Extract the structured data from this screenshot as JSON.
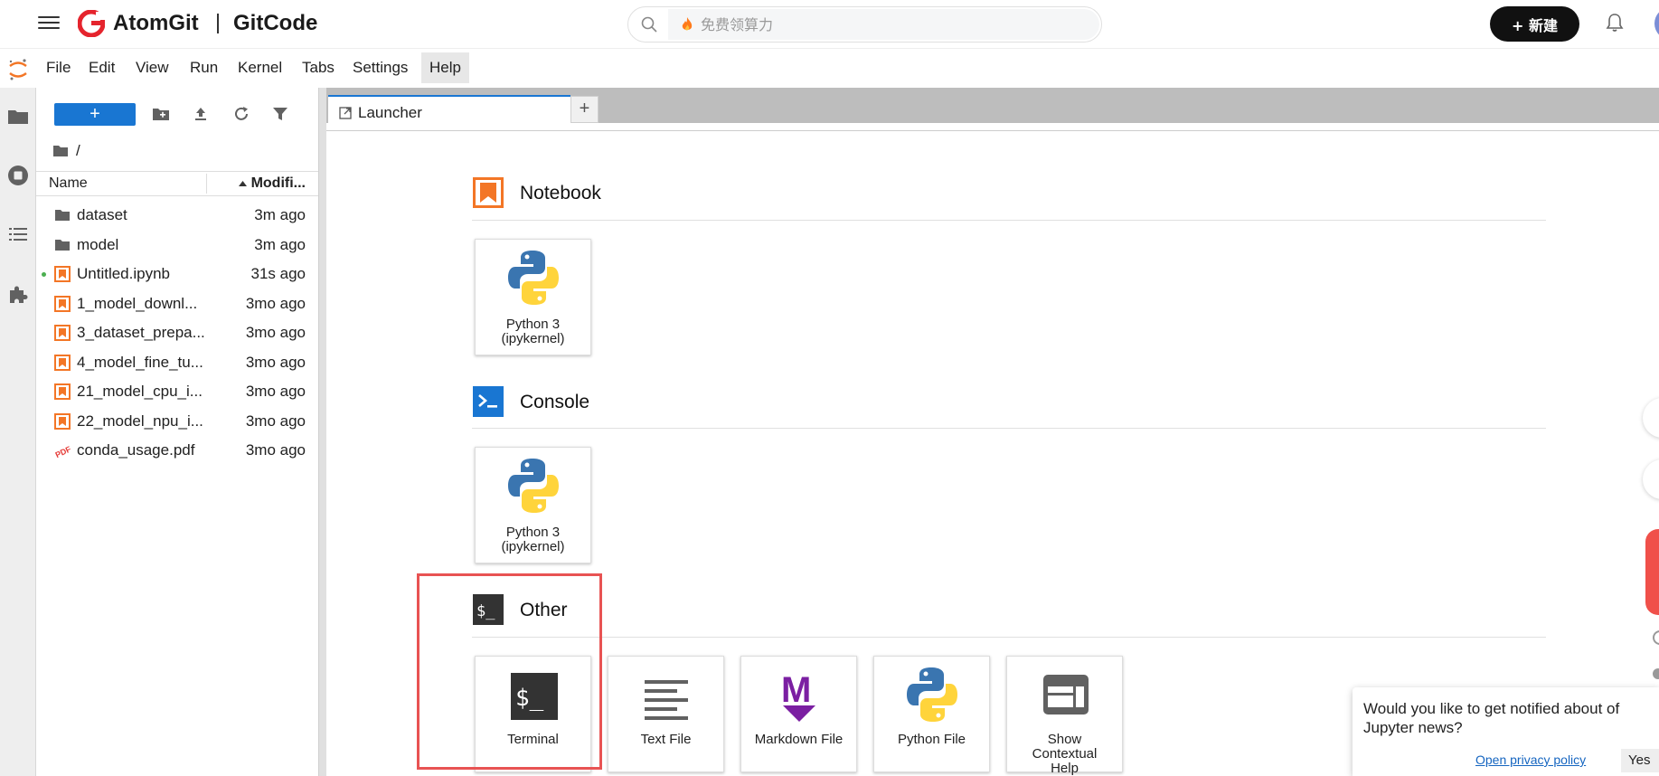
{
  "header": {
    "brand_atom": "AtomGit",
    "brand_gitcode": "GitCode",
    "search_placeholder": "免费领算力",
    "new_button": "+ 新建",
    "brand_color": "#e5242d"
  },
  "menu": {
    "items": [
      "File",
      "Edit",
      "View",
      "Run",
      "Kernel",
      "Tabs",
      "Settings",
      "Help"
    ],
    "active": "Help"
  },
  "filebrowser": {
    "new_button": "+",
    "path": "/",
    "columns": {
      "name": "Name",
      "modified": "Modifi..."
    },
    "files": [
      {
        "name": "dataset",
        "modified": "3m ago",
        "type": "folder"
      },
      {
        "name": "model",
        "modified": "3m ago",
        "type": "folder"
      },
      {
        "name": "Untitled.ipynb",
        "modified": "31s ago",
        "type": "notebook",
        "running": true
      },
      {
        "name": "1_model_downl...",
        "modified": "3mo ago",
        "type": "notebook"
      },
      {
        "name": "3_dataset_prepa...",
        "modified": "3mo ago",
        "type": "notebook"
      },
      {
        "name": "4_model_fine_tu...",
        "modified": "3mo ago",
        "type": "notebook"
      },
      {
        "name": "21_model_cpu_i...",
        "modified": "3mo ago",
        "type": "notebook"
      },
      {
        "name": "22_model_npu_i...",
        "modified": "3mo ago",
        "type": "notebook"
      },
      {
        "name": "conda_usage.pdf",
        "modified": "3mo ago",
        "type": "pdf"
      }
    ]
  },
  "tabs": {
    "launcher": "Launcher",
    "add": "+"
  },
  "launcher": {
    "notebook": {
      "title": "Notebook",
      "cards": [
        "Python 3\n(ipykernel)"
      ]
    },
    "console": {
      "title": "Console",
      "cards": [
        "Python 3\n(ipykernel)"
      ]
    },
    "other": {
      "title": "Other",
      "cards": [
        "Terminal",
        "Text File",
        "Markdown File",
        "Python File",
        "Show\nContextual\nHelp"
      ]
    }
  },
  "notification": {
    "text_line1": "Would you like to get notified about of",
    "text_line2": "Jupyter news?",
    "link": "Open privacy policy",
    "yes": "Yes"
  },
  "icons": [
    "menu-icon",
    "gitcode-logo-icon",
    "search-icon",
    "flame-icon",
    "bell-icon",
    "jupyter-logo-icon",
    "folder-icon",
    "running-icon",
    "toc-icon",
    "extension-icon",
    "new-folder-icon",
    "upload-icon",
    "refresh-icon",
    "filter-icon",
    "python-icon",
    "terminal-icon",
    "text-file-icon",
    "markdown-icon",
    "contextual-help-icon"
  ]
}
